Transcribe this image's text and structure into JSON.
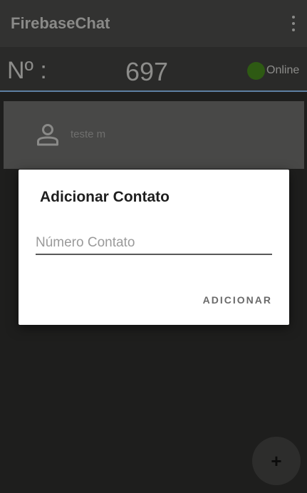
{
  "app_bar": {
    "title": "FirebaseChat",
    "menu_icon": "more-vertical-icon"
  },
  "status_bar": {
    "number_label": "Nº :",
    "number_value": "697",
    "online_label": "Online",
    "online_color": "#2e5a13",
    "divider_color": "#5d7fa2"
  },
  "contacts": [
    {
      "name": "teste m",
      "icon": "person-icon"
    }
  ],
  "dialog": {
    "title": "Adicionar Contato",
    "input_placeholder": "Número Contato",
    "input_value": "",
    "action_label": "ADICIONAR"
  },
  "fab": {
    "label": "+",
    "icon": "add-icon"
  }
}
